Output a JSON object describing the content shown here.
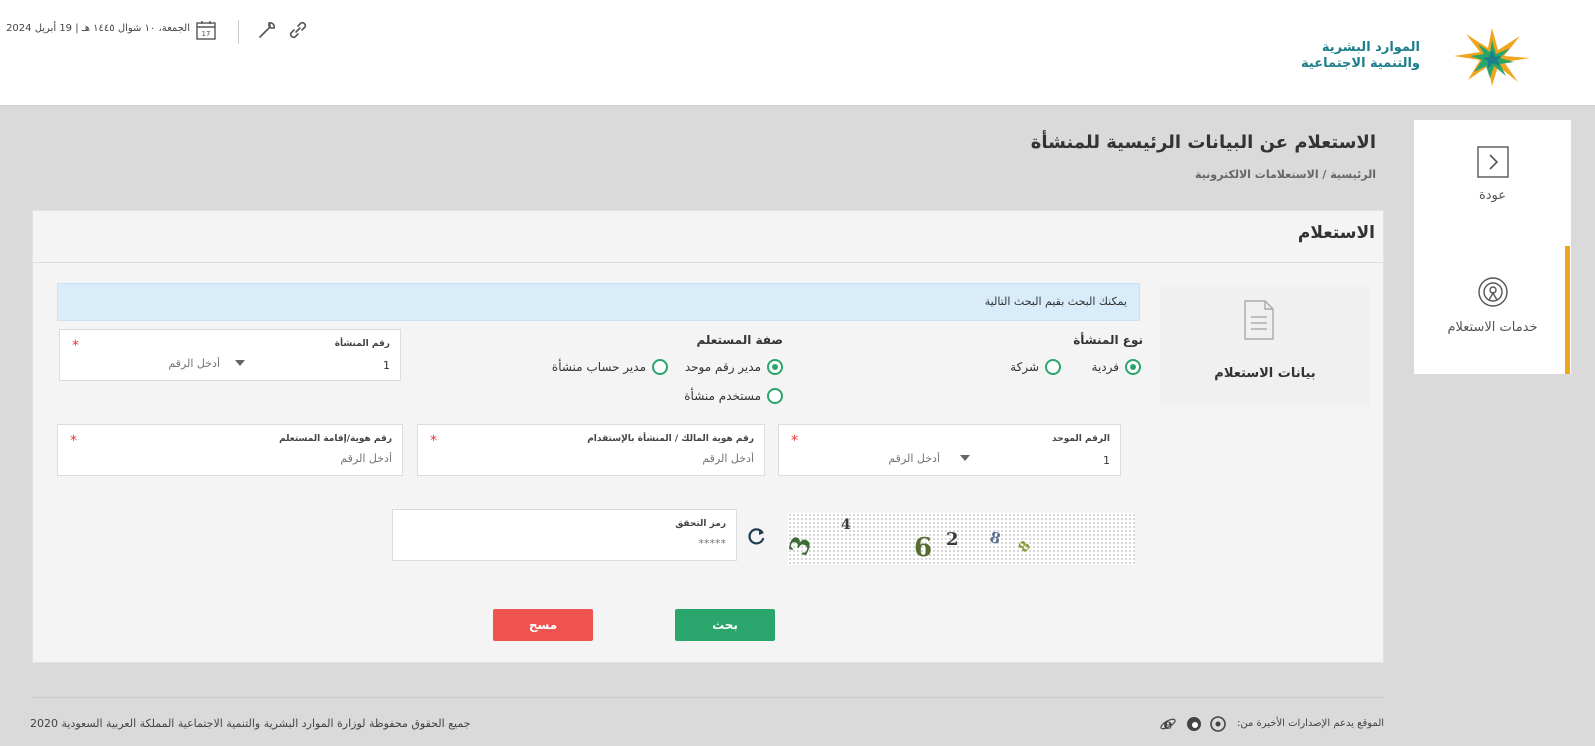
{
  "header": {
    "logo_line1": "الموارد البشرية",
    "logo_line2": "والتنمية الاجتماعية",
    "date": "الجمعة، ١٠ شوال ١٤٤٥ هـ | 19 أبريل 2024",
    "calendar_day": "17",
    "colors": {
      "brand_teal": "#1b7e8a",
      "brand_green": "#2aa56c",
      "brand_orange": "#f2a51c"
    }
  },
  "sidebar": {
    "back_label": "عودة",
    "services_label": "خدمات الاستعلام"
  },
  "page": {
    "title": "الاستعلام عن البيانات الرئيسية للمنشأة",
    "breadcrumb": "الرئيسية / الاستعلامات الالكترونية"
  },
  "panel": {
    "title": "الاستعلام",
    "side_card_label": "بيانات الاستعلام",
    "info": "يمكنك البحث بقيم البحث التالية"
  },
  "form": {
    "establishment_type": {
      "label": "نوع المنشأة",
      "options": [
        {
          "label": "فردية",
          "selected": true
        },
        {
          "label": "شركة",
          "selected": false
        }
      ]
    },
    "user_role": {
      "label": "صفة المستعلم",
      "options": [
        {
          "label": "مدير رقم موحد",
          "selected": true
        },
        {
          "label": "مدير حساب منشأة",
          "selected": false
        },
        {
          "label": "مستخدم منشأة",
          "selected": false
        }
      ]
    },
    "establishment_number": {
      "label": "رقم المنشأة",
      "prefix": "1",
      "placeholder": "أدخل الرقم"
    },
    "unified_number": {
      "label": "الرقم الموحد",
      "prefix": "1",
      "placeholder": "أدخل الرقم"
    },
    "owner_id": {
      "label": "رقم هوية المالك / المنشأة بالإستقدام",
      "placeholder": "أدخل الرقم"
    },
    "requester_id": {
      "label": "رقم هوية/إقامة المستعلم",
      "placeholder": "أدخل الرقم"
    },
    "captcha_field": {
      "label": "رمز التحقق",
      "placeholder": "*****"
    },
    "captcha_digits": [
      "3",
      "4",
      "6",
      "2",
      "8",
      "8"
    ],
    "required_mark": "*"
  },
  "buttons": {
    "search": "بحث",
    "clear": "مسح"
  },
  "footer": {
    "copyright": "جميع الحقوق محفوظة لوزارة الموارد البشرية والتنمية الاجتماعية المملكة العربية السعودية 2020",
    "browsers": "الموقع يدعم الإصدارات الأخيرة من:"
  }
}
